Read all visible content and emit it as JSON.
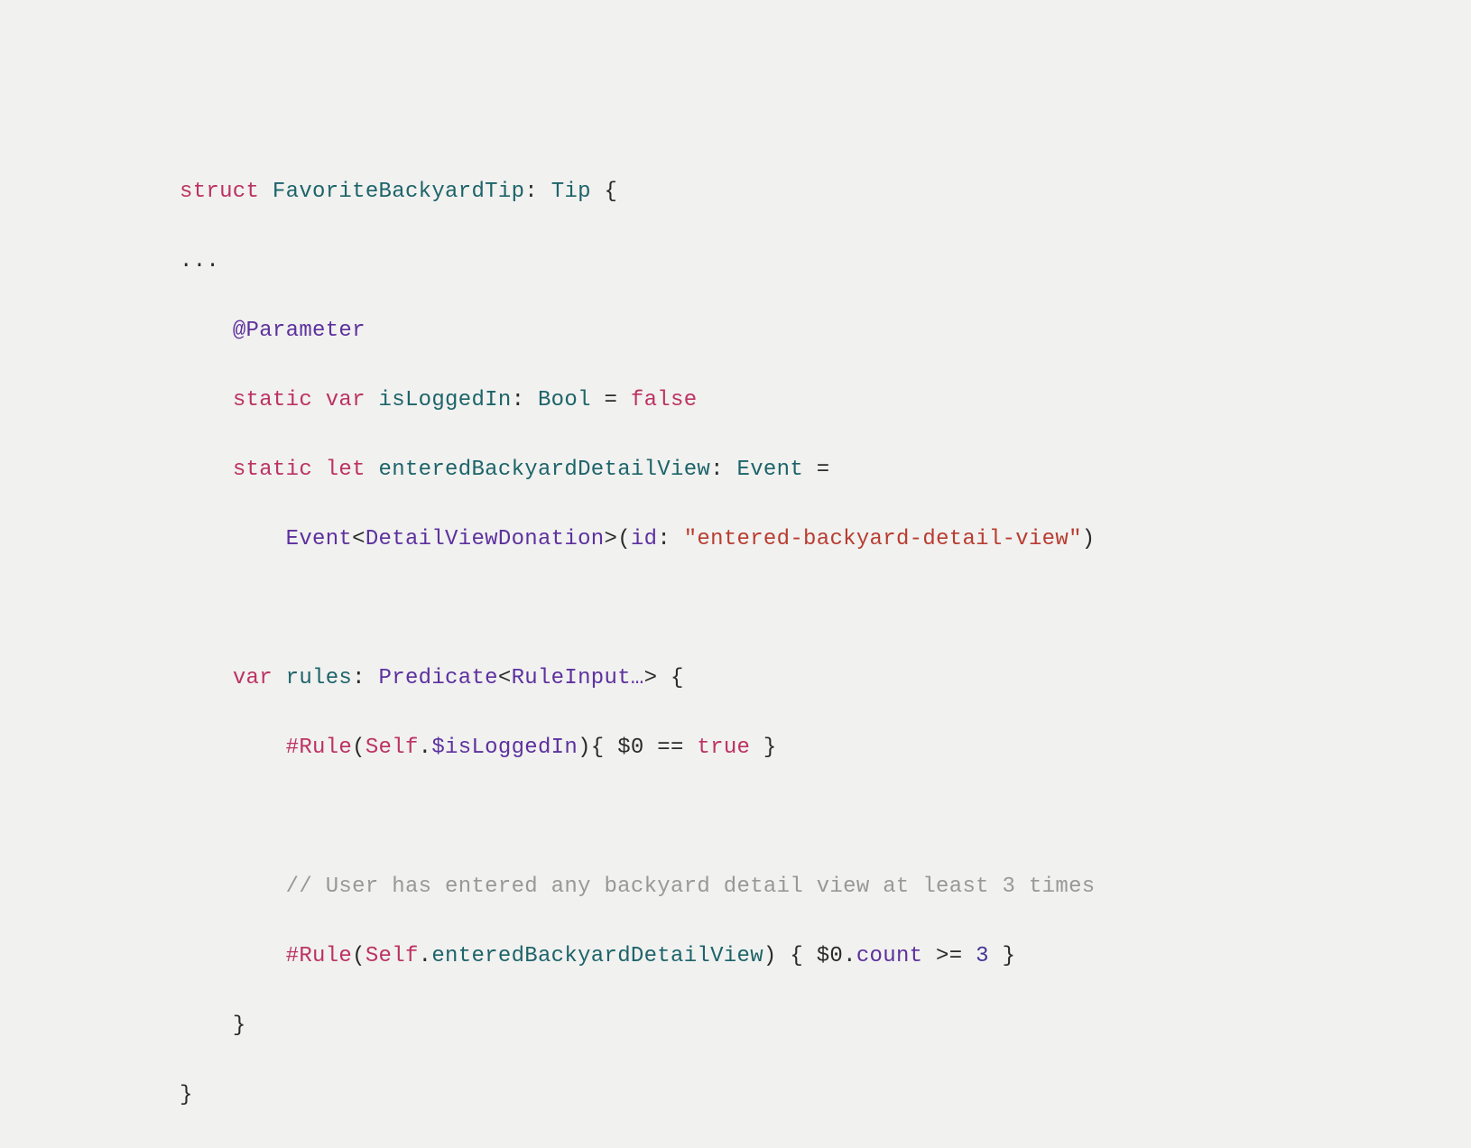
{
  "code": {
    "line1": {
      "kw_struct": "struct",
      "type_name": "FavoriteBackyardTip",
      "colon": ": ",
      "protocol": "Tip",
      "brace": " {"
    },
    "line2": "...",
    "line3": {
      "indent": "    ",
      "attr": "@Parameter"
    },
    "line4": {
      "indent": "    ",
      "kw_static": "static",
      "kw_var": "var",
      "name": "isLoggedIn",
      "colon": ": ",
      "type": "Bool",
      "eq": " = ",
      "val": "false"
    },
    "line5": {
      "indent": "    ",
      "kw_static": "static",
      "kw_let": "let",
      "name": "enteredBackyardDetailView",
      "colon": ": ",
      "type": "Event",
      "eq": " ="
    },
    "line6": {
      "indent": "        ",
      "type": "Event",
      "lt": "<",
      "generic": "DetailViewDonation",
      "gt": ">(",
      "label": "id",
      "colon": ": ",
      "str": "\"entered-backyard-detail-view\"",
      "close": ")"
    },
    "line7": "",
    "line8": {
      "indent": "    ",
      "kw_var": "var",
      "name": "rules",
      "colon": ": ",
      "type": "Predicate",
      "lt": "<",
      "generic": "RuleInput…",
      "gt": "> {"
    },
    "line9": {
      "indent": "        ",
      "rule": "#Rule",
      "open": "(",
      "self": "Self",
      "dot": ".",
      "prop": "$isLoggedIn",
      "close": "){ ",
      "dollar": "$0",
      "eq": " == ",
      "val": "true",
      "end": " }"
    },
    "line10": "",
    "line11": {
      "indent": "        ",
      "comment": "// User has entered any backyard detail view at least 3 times"
    },
    "line12": {
      "indent": "        ",
      "rule": "#Rule",
      "open": "(",
      "self": "Self",
      "dot": ".",
      "prop": "enteredBackyardDetailView",
      "close": ") { ",
      "dollar": "$0",
      "dot2": ".",
      "count": "count",
      "gte": " >= ",
      "num": "3",
      "end": " }"
    },
    "line13": {
      "indent": "    ",
      "brace": "}"
    },
    "line14": "}"
  }
}
